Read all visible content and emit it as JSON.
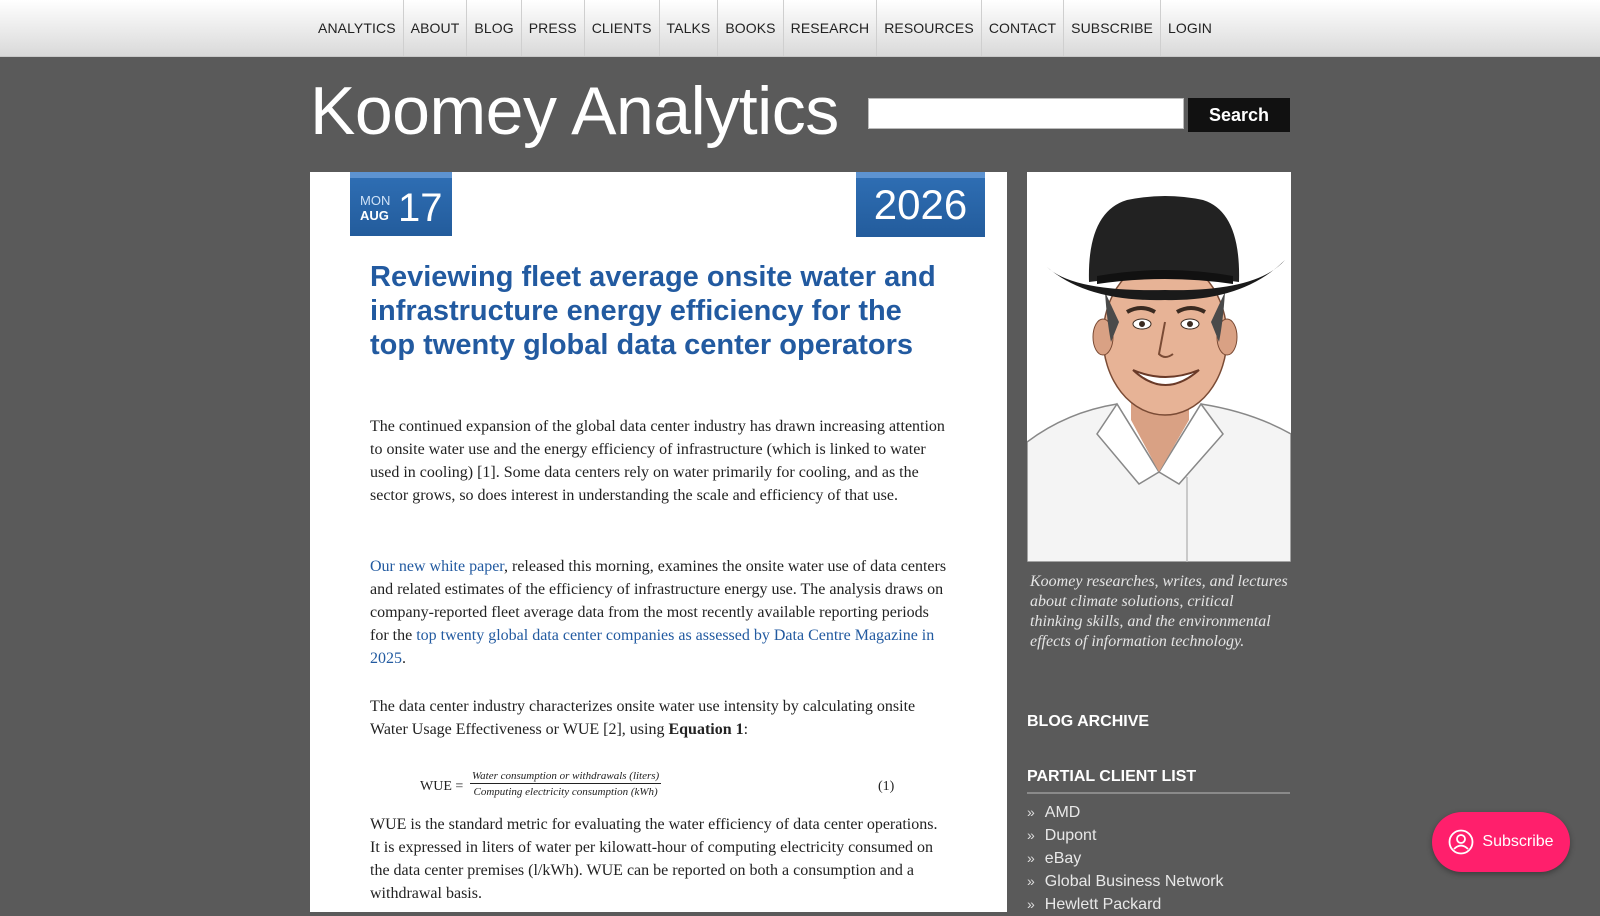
{
  "nav": {
    "items": [
      "ANALYTICS",
      "ABOUT",
      "BLOG",
      "PRESS",
      "CLIENTS",
      "TALKS",
      "BOOKS",
      "RESEARCH",
      "RESOURCES",
      "CONTACT",
      "SUBSCRIBE",
      "LOGIN"
    ]
  },
  "header": {
    "site_title": "Koomey Analytics",
    "search_value": "",
    "search_button": "Search"
  },
  "post": {
    "date": {
      "weekday": "MON",
      "month": "AUG",
      "day": "17",
      "year": "2026"
    },
    "title": "Reviewing fleet average onsite water and infrastructure energy efficiency for the top twenty global data center operators",
    "p1": "The continued expansion of the global data center industry has drawn increasing attention to onsite water use and the energy efficiency of infrastructure (which is linked to water used in cooling) [1]. Some data centers rely on water primarily for cooling, and as the sector grows, so does interest in understanding the scale and efficiency of that use.",
    "p2_link": "Our new white paper",
    "p2_text": ", released this morning, examines the onsite water use of data centers and related estimates of the efficiency of infrastructure energy use. The analysis draws on company-reported fleet average data from the most recently available reporting periods for the ",
    "p2_link2": "top twenty global data center companies as assessed by Data Centre Magazine in 2025",
    "p2_end": ".",
    "p3_text": "The data center industry characterizes onsite water use intensity by calculating onsite Water Usage Effectiveness or WUE [2], using ",
    "p3_bold": "Equation 1",
    "p3_end": ":",
    "equation": {
      "lhs": "WUE =",
      "numerator": "Water consumption or withdrawals (liters)",
      "denominator": "Computing electricity consumption (kWh)",
      "number": "(1)"
    },
    "p4": "WUE is the standard metric for evaluating the water efficiency of data center operations. It is expressed in liters of water per kilowatt-hour of computing electricity consumed on the data center premises (l/kWh). WUE can be reported on both a consumption and a withdrawal basis."
  },
  "sidebar": {
    "caption": "Koomey researches, writes, and lectures about climate solutions, critical thinking skills, and the environmental effects of information technology.",
    "archive_heading": "BLOG ARCHIVE",
    "clients_heading": "PARTIAL CLIENT LIST",
    "clients": [
      "AMD",
      "Dupont",
      "eBay",
      "Global Business Network",
      "Hewlett Packard"
    ]
  },
  "subscribe_pill": {
    "label": "Subscribe"
  },
  "colors": {
    "accent_blue": "#225aa0",
    "subscribe_pink": "#ff1f6c",
    "page_bg": "#5a5a5a"
  }
}
